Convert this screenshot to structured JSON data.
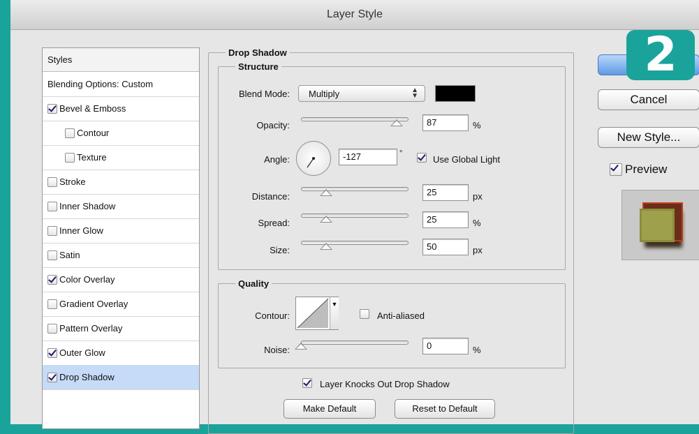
{
  "window": {
    "title": "Layer Style"
  },
  "styles_list": {
    "header": "Styles",
    "items": [
      {
        "label": "Blending Options: Custom",
        "checkbox": false,
        "checked": false,
        "indent": 0,
        "selected": false
      },
      {
        "label": "Bevel & Emboss",
        "checkbox": true,
        "checked": true,
        "indent": 0,
        "selected": false
      },
      {
        "label": "Contour",
        "checkbox": true,
        "checked": false,
        "indent": 1,
        "selected": false
      },
      {
        "label": "Texture",
        "checkbox": true,
        "checked": false,
        "indent": 1,
        "selected": false
      },
      {
        "label": "Stroke",
        "checkbox": true,
        "checked": false,
        "indent": 0,
        "selected": false
      },
      {
        "label": "Inner Shadow",
        "checkbox": true,
        "checked": false,
        "indent": 0,
        "selected": false
      },
      {
        "label": "Inner Glow",
        "checkbox": true,
        "checked": false,
        "indent": 0,
        "selected": false
      },
      {
        "label": "Satin",
        "checkbox": true,
        "checked": false,
        "indent": 0,
        "selected": false
      },
      {
        "label": "Color Overlay",
        "checkbox": true,
        "checked": true,
        "indent": 0,
        "selected": false
      },
      {
        "label": "Gradient Overlay",
        "checkbox": true,
        "checked": false,
        "indent": 0,
        "selected": false
      },
      {
        "label": "Pattern Overlay",
        "checkbox": true,
        "checked": false,
        "indent": 0,
        "selected": false
      },
      {
        "label": "Outer Glow",
        "checkbox": true,
        "checked": true,
        "indent": 0,
        "selected": false
      },
      {
        "label": "Drop Shadow",
        "checkbox": true,
        "checked": true,
        "indent": 0,
        "selected": true
      }
    ]
  },
  "drop_shadow": {
    "title": "Drop Shadow",
    "structure": {
      "title": "Structure",
      "blend_mode_label": "Blend Mode:",
      "blend_mode_value": "Multiply",
      "shadow_color": "#000000",
      "opacity_label": "Opacity:",
      "opacity_value": "87",
      "opacity_unit": "%",
      "angle_label": "Angle:",
      "angle_value": "-127",
      "angle_unit": "°",
      "use_global_light_label": "Use Global Light",
      "use_global_light_checked": true,
      "distance_label": "Distance:",
      "distance_value": "25",
      "distance_unit": "px",
      "spread_label": "Spread:",
      "spread_value": "25",
      "spread_unit": "%",
      "size_label": "Size:",
      "size_value": "50",
      "size_unit": "px"
    },
    "quality": {
      "title": "Quality",
      "contour_label": "Contour:",
      "anti_aliased_label": "Anti-aliased",
      "anti_aliased_checked": false,
      "noise_label": "Noise:",
      "noise_value": "0",
      "noise_unit": "%"
    },
    "knocks_out_label": "Layer Knocks Out Drop Shadow",
    "knocks_out_checked": true,
    "make_default_label": "Make Default",
    "reset_default_label": "Reset to Default"
  },
  "side_buttons": {
    "cancel_label": "Cancel",
    "new_style_label": "New Style...",
    "preview_label": "Preview",
    "preview_checked": true
  },
  "badge": {
    "text": "2",
    "color": "#1aa39a"
  }
}
